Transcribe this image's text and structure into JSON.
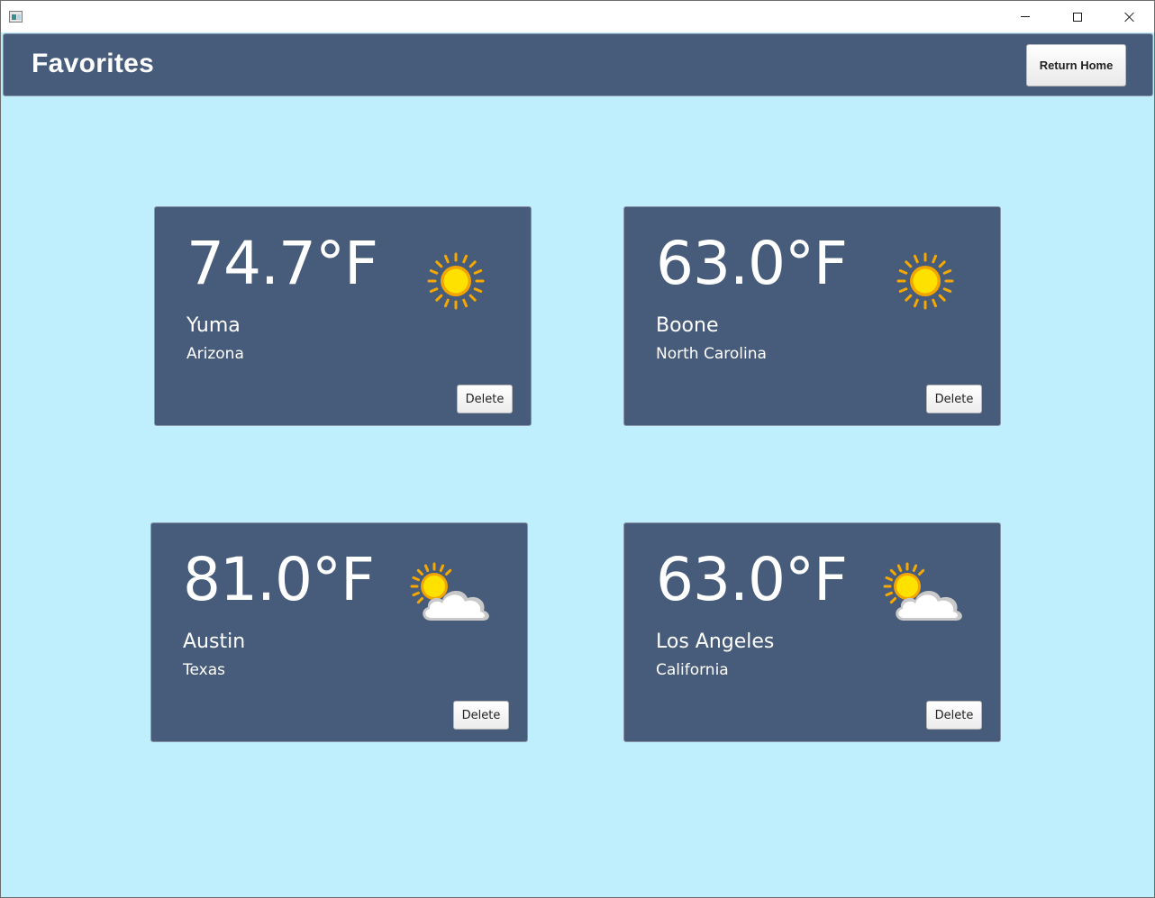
{
  "window": {
    "icon": "app-icon",
    "controls": [
      "minimize-icon",
      "maximize-icon",
      "close-icon"
    ]
  },
  "header": {
    "title": "Favorites",
    "return_label": "Return Home",
    "background": "#475c7a"
  },
  "page_background": "#bfeefc",
  "cards": [
    {
      "temp": "74.7°F",
      "city": "Yuma",
      "state": "Arizona",
      "icon": "sun-icon",
      "delete_label": "Delete"
    },
    {
      "temp": "63.0°F",
      "city": "Boone",
      "state": "North Carolina",
      "icon": "sun-icon",
      "delete_label": "Delete"
    },
    {
      "temp": "81.0°F",
      "city": "Austin",
      "state": "Texas",
      "icon": "partly-cloudy-icon",
      "delete_label": "Delete"
    },
    {
      "temp": "63.0°F",
      "city": "Los Angeles",
      "state": "California",
      "icon": "partly-cloudy-icon",
      "delete_label": "Delete"
    }
  ]
}
